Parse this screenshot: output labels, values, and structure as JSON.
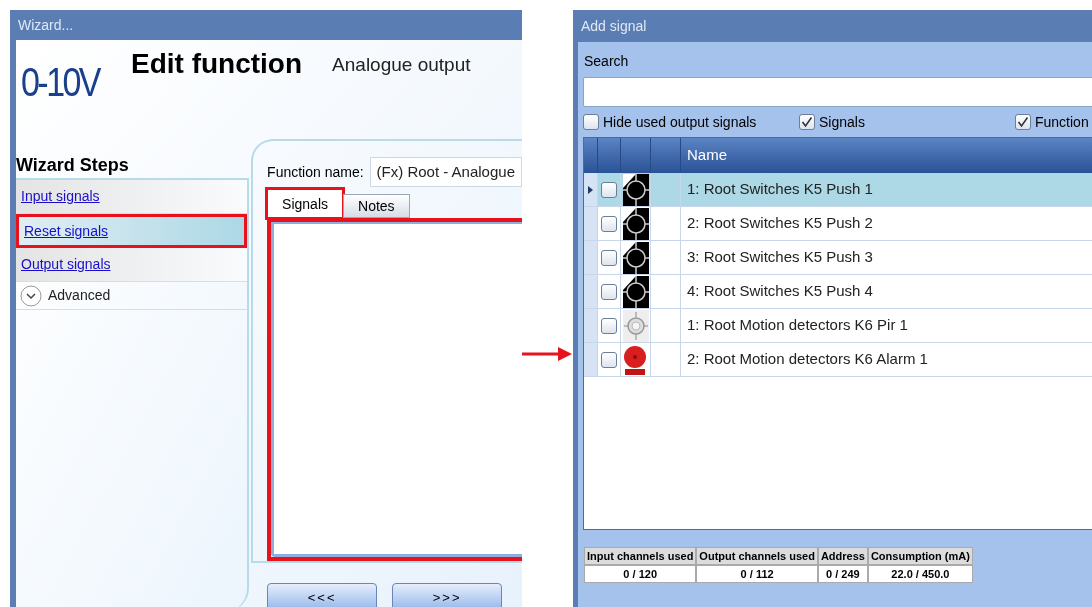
{
  "wizard": {
    "title": "Wizard...",
    "logo": "0-10V",
    "heading": "Edit function",
    "subheading": "Analogue output",
    "steps_title": "Wizard Steps",
    "steps": [
      {
        "label": "Input signals",
        "kind": "link",
        "selected": false,
        "highlighted": false
      },
      {
        "label": "Reset signals",
        "kind": "link",
        "selected": true,
        "highlighted": true
      },
      {
        "label": "Output signals",
        "kind": "link",
        "selected": false,
        "highlighted": false
      },
      {
        "label": "Advanced",
        "kind": "expander",
        "selected": false,
        "highlighted": false
      }
    ],
    "function_name_label": "Function name:",
    "function_name_value": "(Fx) Root - Analogue",
    "tabs": [
      {
        "label": "Signals",
        "selected": true,
        "highlighted": true
      },
      {
        "label": "Notes",
        "selected": false,
        "highlighted": false
      }
    ],
    "panel_highlighted": true,
    "buttons": [
      "<<<",
      ">>>"
    ]
  },
  "add_signal": {
    "title": "Add signal",
    "search_label": "Search",
    "filters": [
      {
        "label": "Hide used output signals",
        "checked": false
      },
      {
        "label": "Signals",
        "checked": true
      },
      {
        "label": "Function",
        "checked": true
      }
    ],
    "table": {
      "columns": [
        "Name"
      ],
      "rows": [
        {
          "name": "1: Root Switches K5 Push 1",
          "kind": "switch",
          "checked": false,
          "selected": true
        },
        {
          "name": "2: Root Switches K5 Push 2",
          "kind": "switch",
          "checked": false,
          "selected": false
        },
        {
          "name": "3: Root Switches K5 Push 3",
          "kind": "switch",
          "checked": false,
          "selected": false
        },
        {
          "name": "4: Root Switches K5 Push 4",
          "kind": "switch",
          "checked": false,
          "selected": false
        },
        {
          "name": "1: Root Motion detectors K6 Pir 1",
          "kind": "motion",
          "checked": false,
          "selected": false
        },
        {
          "name": "2: Root Motion detectors K6 Alarm 1",
          "kind": "alarm",
          "checked": false,
          "selected": false
        }
      ]
    },
    "status": [
      {
        "label": "Input channels used",
        "value": "0 / 120"
      },
      {
        "label": "Output channels used",
        "value": "0 / 112"
      },
      {
        "label": "Address",
        "value": "0 / 249"
      },
      {
        "label": "Consumption (mA)",
        "value": "22.0 / 450.0"
      }
    ]
  }
}
